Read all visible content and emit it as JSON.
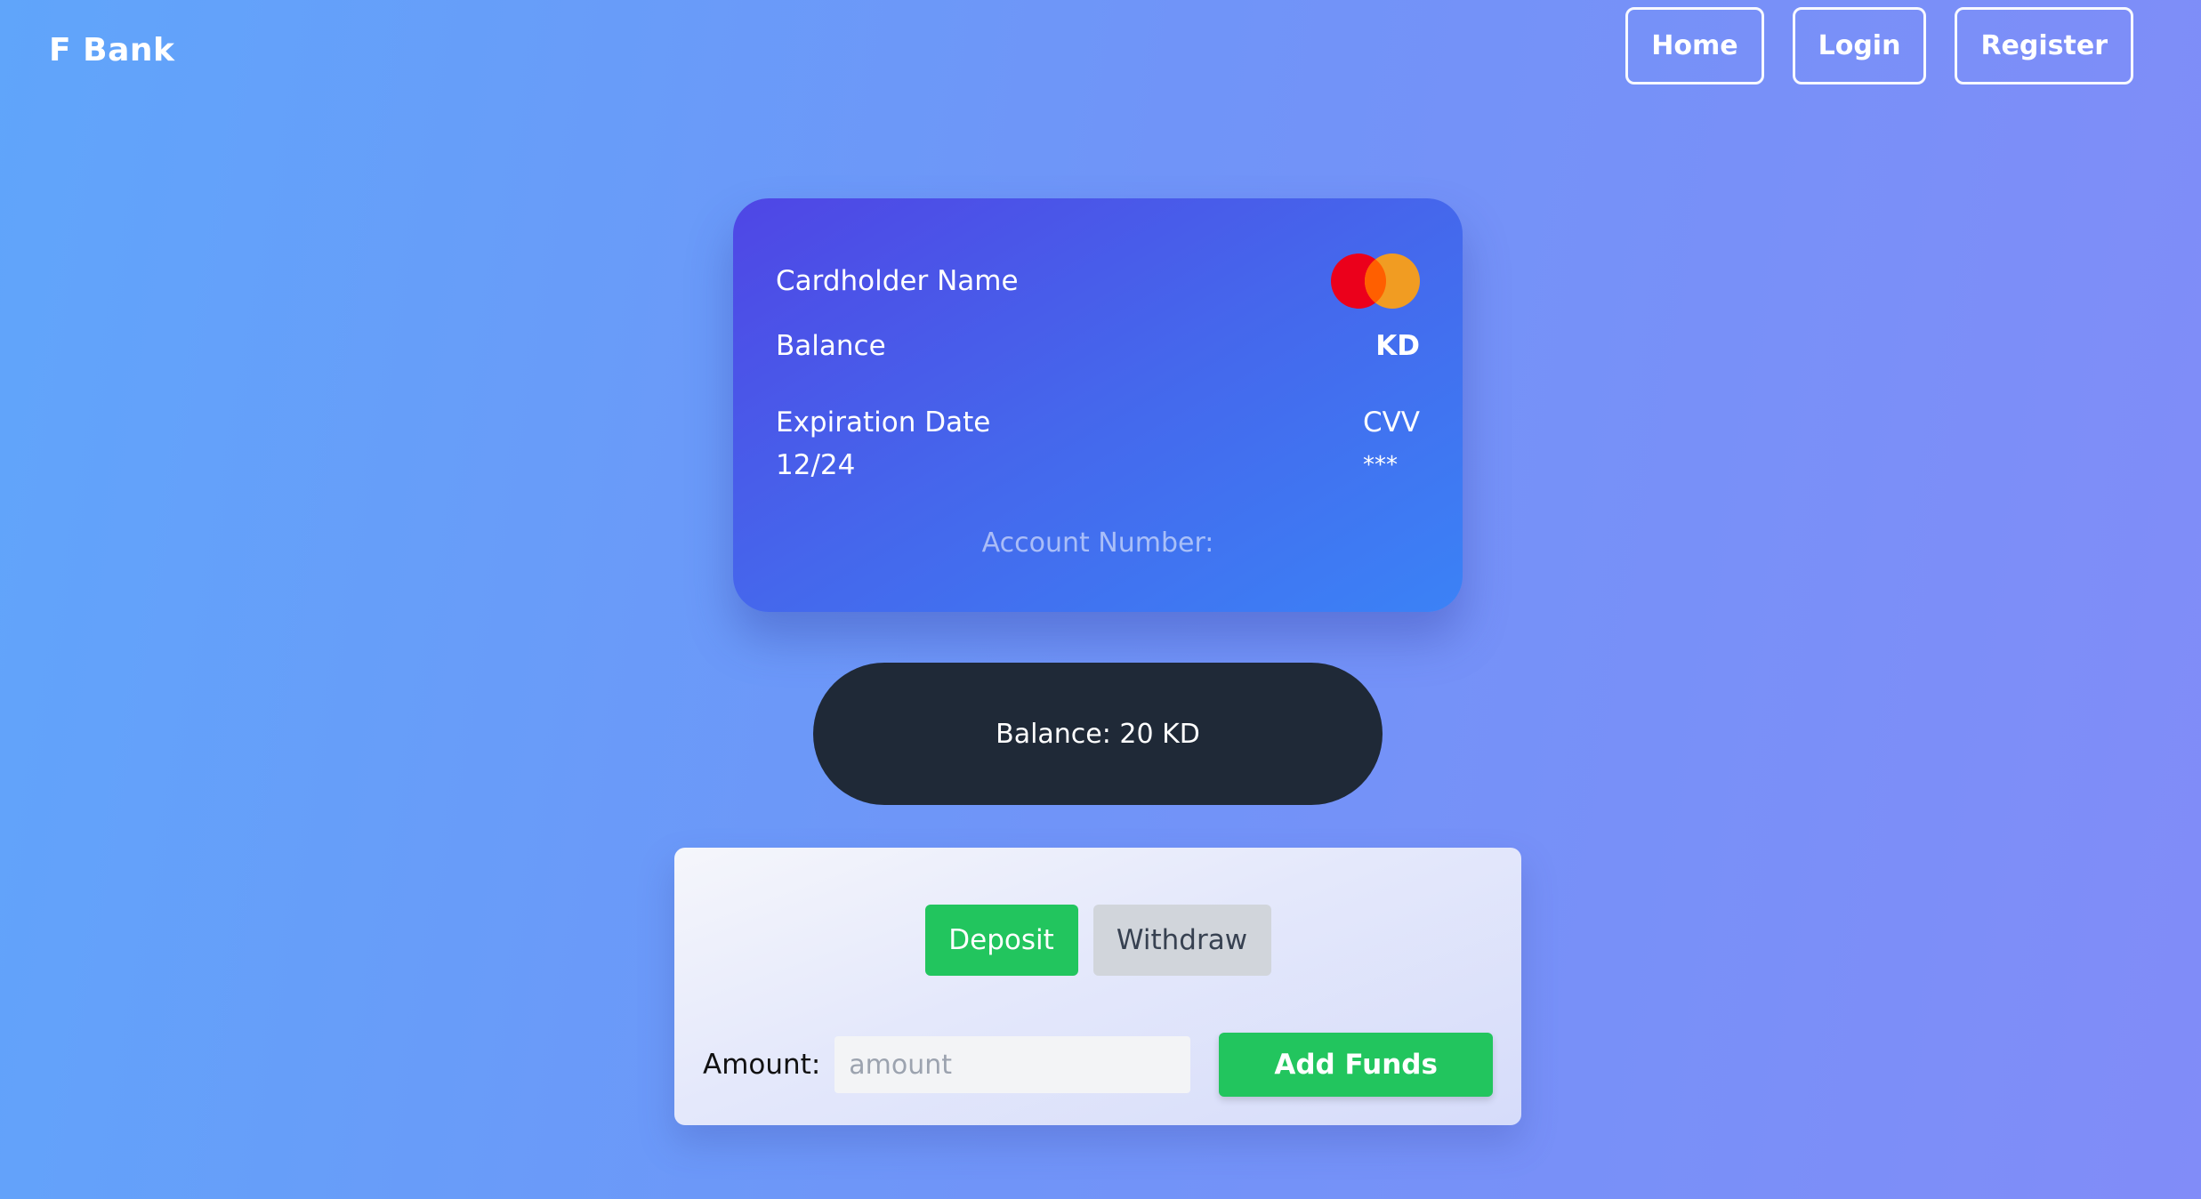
{
  "header": {
    "brand": "F Bank",
    "nav": [
      "Home",
      "Login",
      "Register"
    ]
  },
  "card": {
    "cardholder_label": "Cardholder Name",
    "logo_icon": "mastercard-logo-icon",
    "balance_label": "Balance",
    "balance_currency": "KD",
    "expiration_label": "Expiration Date",
    "expiration_value": "12/24",
    "cvv_label": "CVV",
    "cvv_value": "***",
    "account_number_label": "Account Number:"
  },
  "balance_pill": {
    "text": "Balance: 20 KD"
  },
  "transaction": {
    "tabs": [
      {
        "label": "Deposit",
        "active": true
      },
      {
        "label": "Withdraw",
        "active": false
      }
    ],
    "amount_label": "Amount:",
    "amount_placeholder": "amount",
    "amount_value": "",
    "submit_label": "Add Funds"
  },
  "colors": {
    "accent_green": "#22c55e",
    "pill_dark": "#1f2937",
    "card_start": "#4f46e5",
    "card_end": "#3b82f6"
  }
}
